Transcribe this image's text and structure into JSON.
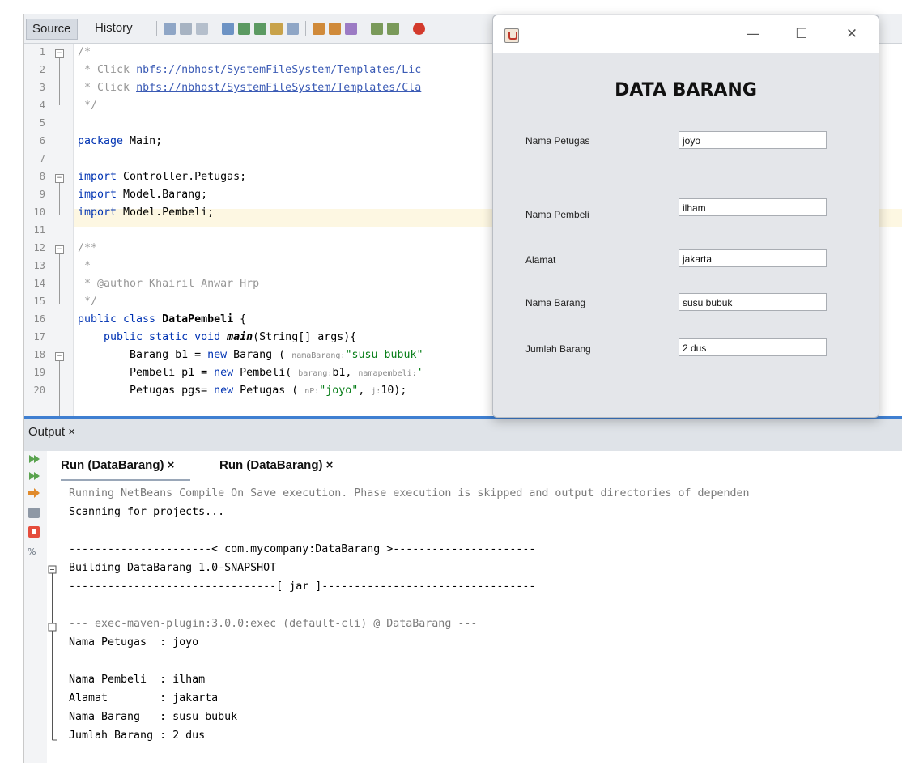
{
  "editor": {
    "tabs": [
      {
        "label": "Source"
      },
      {
        "label": "History"
      }
    ],
    "line_numbers": [
      "1",
      "2",
      "3",
      "4",
      "5",
      "6",
      "7",
      "8",
      "9",
      "10",
      "11",
      "12",
      "13",
      "14",
      "15",
      "16",
      "17",
      "18",
      "19",
      "20"
    ],
    "code_lines": {
      "l1": "/*",
      "l2_pre": " * Click ",
      "l2_link": "nbfs://nbhost/SystemFileSystem/Templates/Lic",
      "l3_pre": " * Click ",
      "l3_link": "nbfs://nbhost/SystemFileSystem/Templates/Cla",
      "l4": " */",
      "l6_kw": "package",
      "l6_rest": " Main;",
      "l8_kw": "import",
      "l8_rest": " Controller.Petugas;",
      "l9_kw": "import",
      "l9_rest": " Model.Barang;",
      "l10_kw": "import",
      "l10_rest": " Model.Pembeli;",
      "l12": "/**",
      "l13": " *",
      "l14": " * @author Khairil Anwar Hrp",
      "l15": " */",
      "l16_kw": "public class",
      "l16_name": " DataPembeli",
      "l16_rest": " {",
      "l17_kw": "    public static void",
      "l17_name": " main",
      "l17_rest": "(String[] args){",
      "l18_a": "        Barang b1 = ",
      "l18_kw": "new",
      "l18_b": " Barang ( ",
      "l18_hint": "namaBarang:",
      "l18_str": "\"susu bubuk\"",
      "l19_a": "        Pembeli p1 = ",
      "l19_kw": "new",
      "l19_b": " Pembeli( ",
      "l19_hint1": "barang:",
      "l19_c": "b1, ",
      "l19_hint2": "namapembeli:",
      "l19_str": "'",
      "l20_a": "        Petugas pgs= ",
      "l20_kw": "new",
      "l20_b": " Petugas ( ",
      "l20_hint1": "nP:",
      "l20_str": "\"joyo\"",
      "l20_c": ", ",
      "l20_hint2": "j:",
      "l20_d": "10);"
    }
  },
  "output": {
    "title": "Output ×",
    "run_tabs": [
      "Run (DataBarang)  ×",
      "Run (DataBarang)  ×"
    ],
    "lines": [
      "Running NetBeans Compile On Save execution. Phase execution is skipped and output directories of dependen",
      "Scanning for projects...",
      "",
      "----------------------< com.mycompany:DataBarang >----------------------",
      "Building DataBarang 1.0-SNAPSHOT",
      "--------------------------------[ jar ]---------------------------------",
      "",
      "--- exec-maven-plugin:3.0.0:exec (default-cli) @ DataBarang ---",
      "Nama Petugas  : joyo",
      "",
      "Nama Pembeli  : ilham",
      "Alamat        : jakarta",
      "Nama Barang   : susu bubuk",
      "Jumlah Barang : 2 dus"
    ]
  },
  "dialog": {
    "heading": "DATA BARANG",
    "controls": {
      "minimize": "—",
      "maximize": "☐",
      "close": "✕"
    },
    "fields": [
      {
        "label": "Nama Petugas",
        "value": "joyo"
      },
      {
        "label": "Nama Pembeli",
        "value": "ilham"
      },
      {
        "label": "Alamat",
        "value": "jakarta"
      },
      {
        "label": "Nama Barang",
        "value": "susu bubuk"
      },
      {
        "label": "Jumlah Barang",
        "value": "2 dus"
      }
    ]
  },
  "colors": {
    "keyword": "#0033b3",
    "string": "#067d17",
    "comment": "#969696",
    "accent": "#3f7fd1"
  }
}
